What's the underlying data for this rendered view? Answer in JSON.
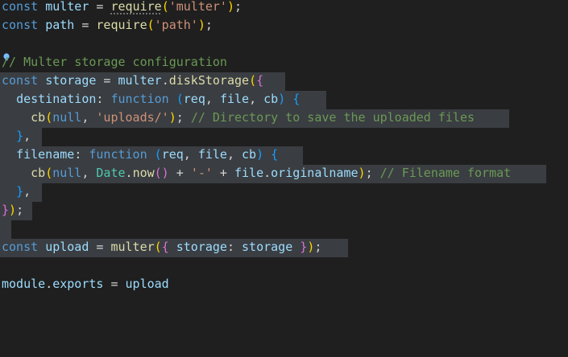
{
  "editor": {
    "lines": [
      {
        "tokens": [
          [
            "k",
            "const"
          ],
          [
            "pl",
            " "
          ],
          [
            "v",
            "multer"
          ],
          [
            "pl",
            " = "
          ],
          [
            "fn",
            "require"
          ],
          [
            "br1",
            "("
          ],
          [
            "str",
            "'multer'"
          ],
          [
            "br1",
            ")"
          ],
          [
            "pl",
            ";"
          ]
        ]
      },
      {
        "tokens": [
          [
            "k",
            "const"
          ],
          [
            "pl",
            " "
          ],
          [
            "v",
            "path"
          ],
          [
            "pl",
            " = "
          ],
          [
            "fn",
            "require"
          ],
          [
            "br1",
            "("
          ],
          [
            "str",
            "'path'"
          ],
          [
            "br1",
            ")"
          ],
          [
            "pl",
            ";"
          ]
        ]
      },
      {
        "tokens": []
      },
      {
        "tokens": [
          [
            "cm",
            "// Multer storage configuration"
          ]
        ]
      },
      {
        "tokens": [
          [
            "k",
            "const"
          ],
          [
            "pl",
            " "
          ],
          [
            "v",
            "storage"
          ],
          [
            "pl",
            " = "
          ],
          [
            "v",
            "multer"
          ],
          [
            "pl",
            "."
          ],
          [
            "fn",
            "diskStorage"
          ],
          [
            "br1",
            "("
          ],
          [
            "br2",
            "{"
          ]
        ]
      },
      {
        "tokens": [
          [
            "pl",
            "  "
          ],
          [
            "v",
            "destination"
          ],
          [
            "pl",
            ": "
          ],
          [
            "k",
            "function"
          ],
          [
            "pl",
            " "
          ],
          [
            "br3",
            "("
          ],
          [
            "v",
            "req"
          ],
          [
            "pl",
            ", "
          ],
          [
            "v",
            "file"
          ],
          [
            "pl",
            ", "
          ],
          [
            "v",
            "cb"
          ],
          [
            "br3",
            ")"
          ],
          [
            "pl",
            " "
          ],
          [
            "br3",
            "{"
          ]
        ]
      },
      {
        "tokens": [
          [
            "pl",
            "    "
          ],
          [
            "fn",
            "cb"
          ],
          [
            "br1",
            "("
          ],
          [
            "k",
            "null"
          ],
          [
            "pl",
            ", "
          ],
          [
            "str",
            "'uploads/'"
          ],
          [
            "br1",
            ")"
          ],
          [
            "pl",
            "; "
          ],
          [
            "cm",
            "// Directory to save the uploaded files"
          ]
        ]
      },
      {
        "tokens": [
          [
            "pl",
            "  "
          ],
          [
            "br3",
            "}"
          ],
          [
            "pl",
            ","
          ]
        ]
      },
      {
        "tokens": [
          [
            "pl",
            "  "
          ],
          [
            "v",
            "filename"
          ],
          [
            "pl",
            ": "
          ],
          [
            "k",
            "function"
          ],
          [
            "pl",
            " "
          ],
          [
            "br3",
            "("
          ],
          [
            "v",
            "req"
          ],
          [
            "pl",
            ", "
          ],
          [
            "v",
            "file"
          ],
          [
            "pl",
            ", "
          ],
          [
            "v",
            "cb"
          ],
          [
            "br3",
            ")"
          ],
          [
            "pl",
            " "
          ],
          [
            "br3",
            "{"
          ]
        ]
      },
      {
        "tokens": [
          [
            "pl",
            "    "
          ],
          [
            "fn",
            "cb"
          ],
          [
            "br1",
            "("
          ],
          [
            "k",
            "null"
          ],
          [
            "pl",
            ", "
          ],
          [
            "cls",
            "Date"
          ],
          [
            "pl",
            "."
          ],
          [
            "fn",
            "now"
          ],
          [
            "br2",
            "()"
          ],
          [
            "pl",
            " + "
          ],
          [
            "str",
            "'-'"
          ],
          [
            "pl",
            " + "
          ],
          [
            "v",
            "file"
          ],
          [
            "pl",
            "."
          ],
          [
            "v",
            "originalname"
          ],
          [
            "br1",
            ")"
          ],
          [
            "pl",
            "; "
          ],
          [
            "cm",
            "// Filename format"
          ]
        ]
      },
      {
        "tokens": [
          [
            "pl",
            "  "
          ],
          [
            "br3",
            "}"
          ],
          [
            "pl",
            ","
          ]
        ]
      },
      {
        "tokens": [
          [
            "br2",
            "}"
          ],
          [
            "br1",
            ")"
          ],
          [
            "pl",
            ";"
          ]
        ]
      },
      {
        "tokens": []
      },
      {
        "tokens": [
          [
            "k",
            "const"
          ],
          [
            "pl",
            " "
          ],
          [
            "v",
            "upload"
          ],
          [
            "pl",
            " = "
          ],
          [
            "fn",
            "multer"
          ],
          [
            "br1",
            "("
          ],
          [
            "br2",
            "{"
          ],
          [
            "pl",
            " "
          ],
          [
            "v",
            "storage"
          ],
          [
            "pl",
            ": "
          ],
          [
            "v",
            "storage"
          ],
          [
            "pl",
            " "
          ],
          [
            "br2",
            "}"
          ],
          [
            "br1",
            ")"
          ],
          [
            "pl",
            ";"
          ]
        ]
      },
      {
        "tokens": []
      },
      {
        "tokens": [
          [
            "v",
            "module"
          ],
          [
            "pl",
            "."
          ],
          [
            "v",
            "exports"
          ],
          [
            "pl",
            " = "
          ],
          [
            "v",
            "upload"
          ]
        ]
      }
    ]
  },
  "icons": {
    "lightbulb": "lightbulb-icon"
  }
}
